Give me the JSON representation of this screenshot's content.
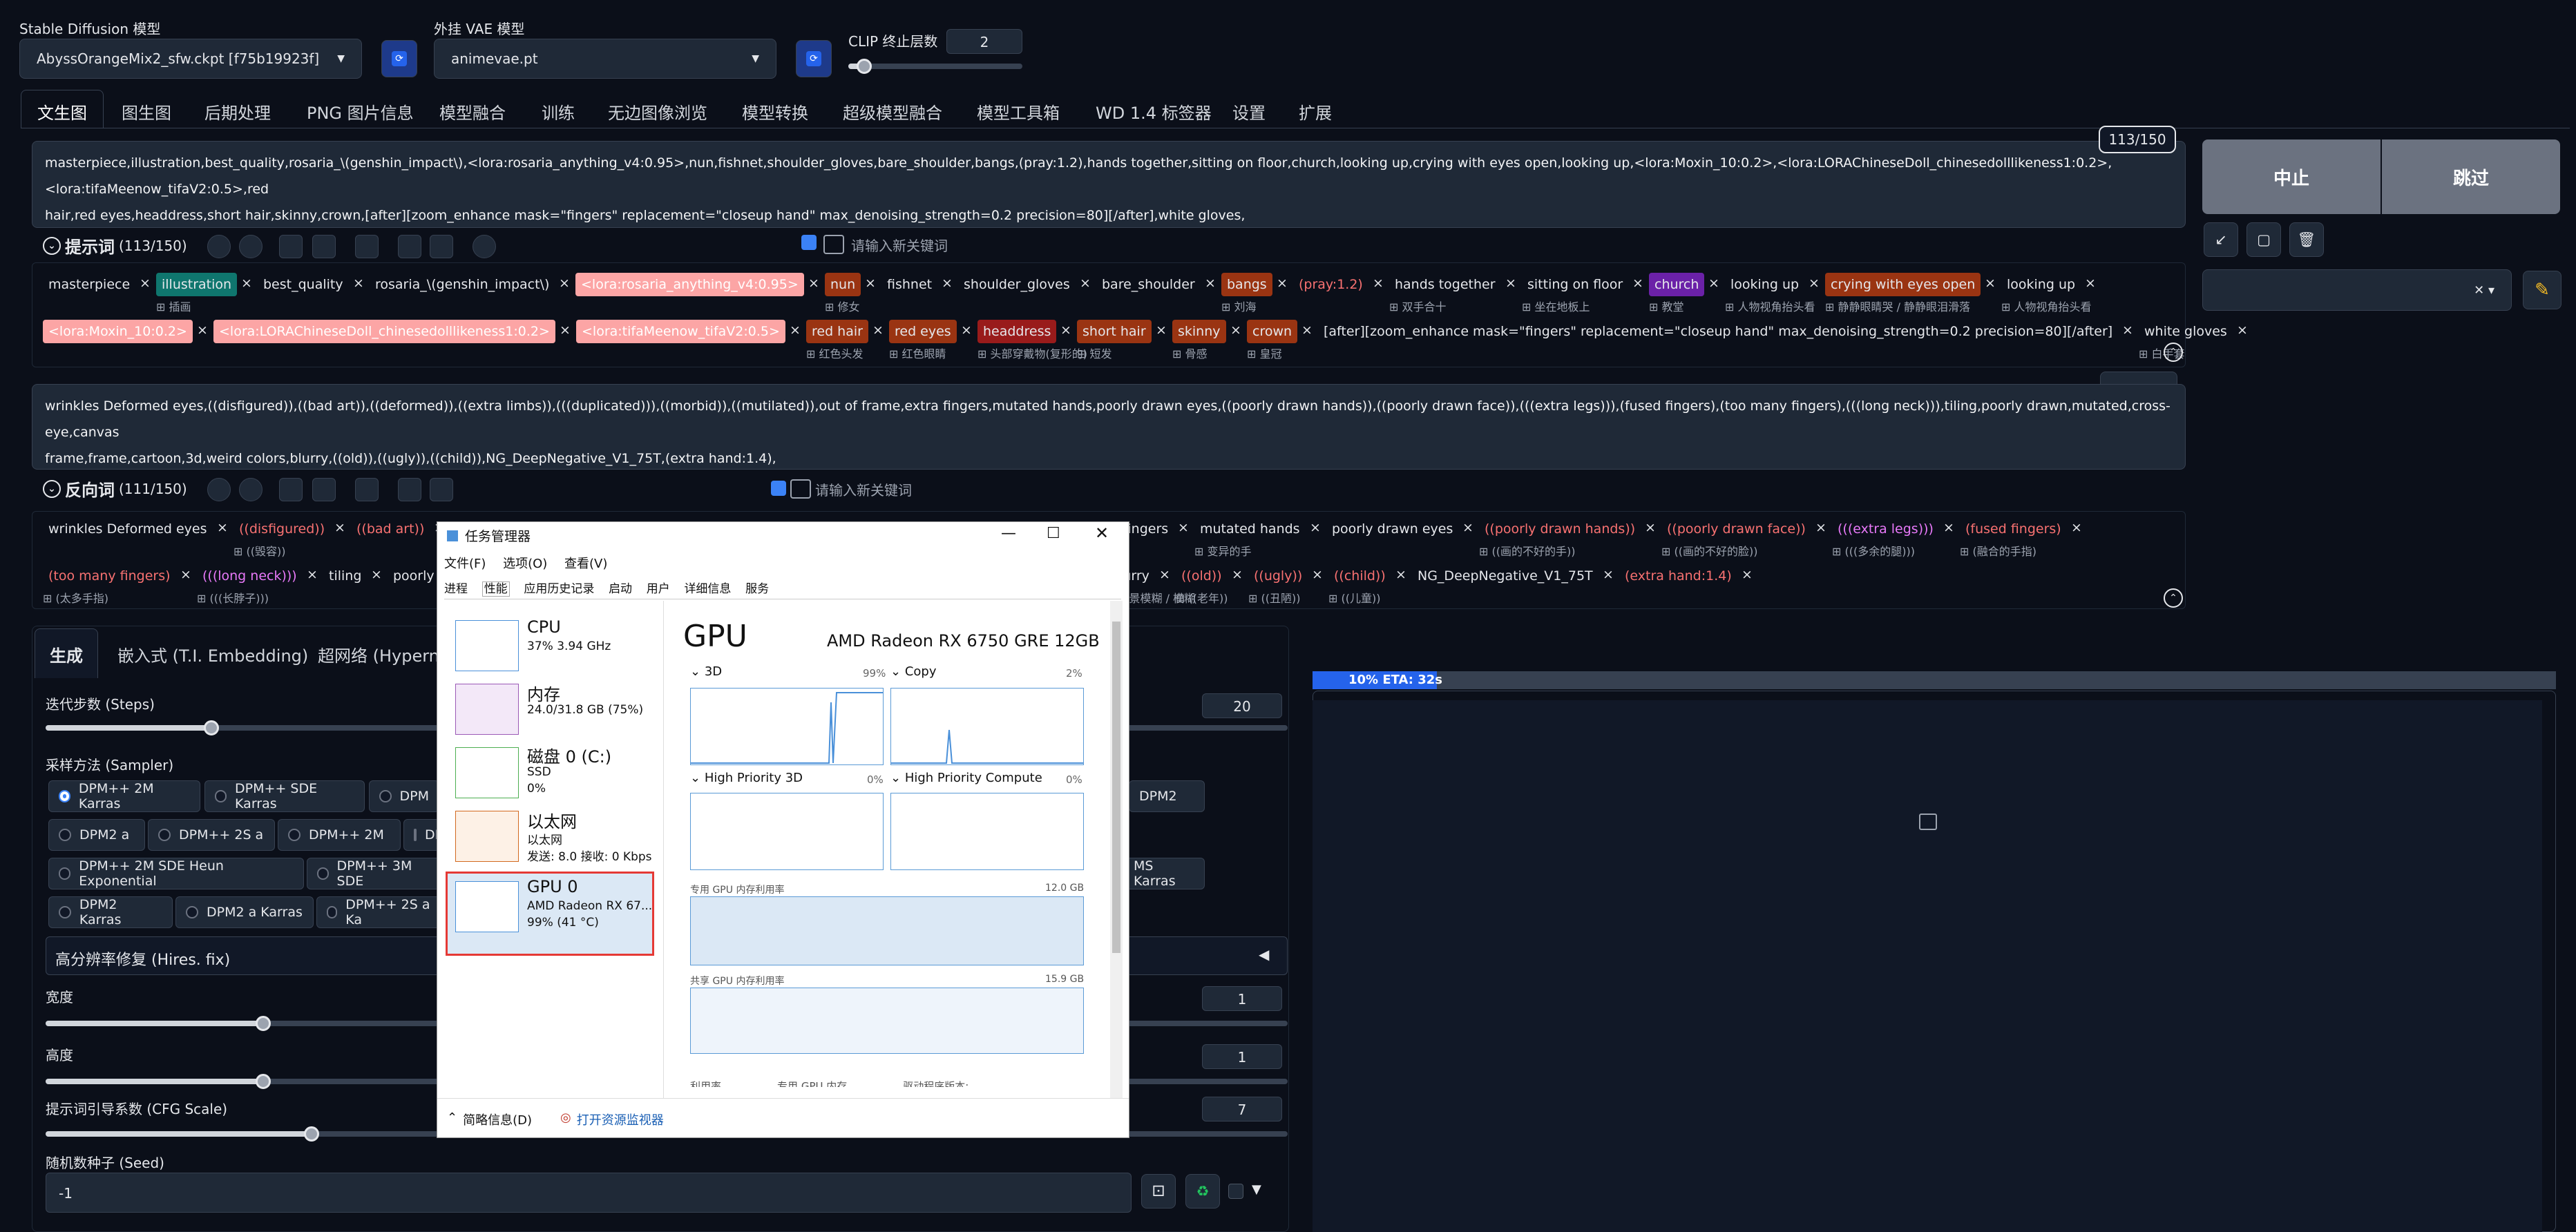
{
  "top": {
    "sd_model_label": "Stable Diffusion 模型",
    "sd_model_value": "AbyssOrangeMix2_sfw.ckpt [f75b19923f]",
    "vae_label": "外挂 VAE 模型",
    "vae_value": "animevae.pt",
    "clip_label": "CLIP 终止层数",
    "clip_value": "2"
  },
  "tabs": [
    "文生图",
    "图生图",
    "后期处理",
    "PNG 图片信息",
    "模型融合",
    "训练",
    "无边图像浏览",
    "模型转换",
    "超级模型融合",
    "模型工具箱",
    "WD 1.4 标签器",
    "设置",
    "扩展"
  ],
  "prompt": {
    "counter": "113/150",
    "line1": "masterpiece,illustration,best_quality,rosaria_\\(genshin_impact\\),<lora:rosaria_anything_v4:0.95>,nun,fishnet,shoulder_gloves,bare_shoulder,bangs,(pray:1.2),hands together,sitting on floor,church,looking up,crying with eyes open,looking up,<lora:Moxin_10:0.2>,<lora:LORAChineseDoll_chinesedolllikeness1:0.2>,<lora:tifaMeenow_tifaV2:0.5>,red",
    "line2": "hair,red eyes,headdress,short hair,skinny,crown,[after][zoom_enhance mask=\"fingers\" replacement=\"closeup hand\" max_denoising_strength=0.2 precision=80][/after],white gloves,",
    "header_label": "提示词",
    "header_count": "(113/150)",
    "new_keyword": "请输入新关键词"
  },
  "prompt_chips": [
    {
      "t": "masterpiece",
      "c": "",
      "s": ""
    },
    {
      "t": "illustration",
      "c": "cyan",
      "s": "插画"
    },
    {
      "t": "best_quality",
      "c": "",
      "s": ""
    },
    {
      "t": "rosaria_\\(genshin_impact\\)",
      "c": "",
      "s": ""
    },
    {
      "t": "<lora:rosaria_anything_v4:0.95>",
      "c": "pink",
      "s": ""
    },
    {
      "t": "nun",
      "c": "orange",
      "s": "修女"
    },
    {
      "t": "fishnet",
      "c": "",
      "s": ""
    },
    {
      "t": "shoulder_gloves",
      "c": "",
      "s": ""
    },
    {
      "t": "bare_shoulder",
      "c": "",
      "s": ""
    },
    {
      "t": "bangs",
      "c": "orange",
      "s": "刘海"
    },
    {
      "t": "(pray:1.2)",
      "c": "red",
      "s": ""
    },
    {
      "t": "hands together",
      "c": "",
      "s": "双手合十"
    },
    {
      "t": "sitting on floor",
      "c": "",
      "s": "坐在地板上"
    },
    {
      "t": "church",
      "c": "purple",
      "s": "教堂"
    },
    {
      "t": "looking up",
      "c": "",
      "s": "人物视角抬头看"
    },
    {
      "t": "crying with eyes open",
      "c": "orange",
      "s": "静静眼睛哭 / 静静眼泪滑落"
    },
    {
      "t": "looking up",
      "c": "",
      "s": "人物视角抬头看"
    },
    {
      "t": "<lora:Moxin_10:0.2>",
      "c": "pink",
      "s": ""
    },
    {
      "t": "<lora:LORAChineseDoll_chinesedolllikeness1:0.2>",
      "c": "pink",
      "s": ""
    },
    {
      "t": "<lora:tifaMeenow_tifaV2:0.5>",
      "c": "pink",
      "s": ""
    },
    {
      "t": "red hair",
      "c": "orange",
      "s": "红色头发"
    },
    {
      "t": "red eyes",
      "c": "orange",
      "s": "红色眼睛"
    },
    {
      "t": "headdress",
      "c": "redb",
      "s": "头部穿戴物(复形的)"
    },
    {
      "t": "short hair",
      "c": "orange",
      "s": "短发"
    },
    {
      "t": "skinny",
      "c": "orange",
      "s": "骨感"
    },
    {
      "t": "crown",
      "c": "orange",
      "s": "皇冠"
    },
    {
      "t": "[after][zoom_enhance mask=\"fingers\" replacement=\"closeup hand\" max_denoising_strength=0.2 precision=80][/after]",
      "c": "",
      "s": ""
    },
    {
      "t": "white gloves",
      "c": "",
      "s": "白手套"
    }
  ],
  "negative": {
    "line1": "wrinkles Deformed eyes,((disfigured)),((bad art)),((deformed)),((extra limbs)),(((duplicated))),((morbid)),((mutilated)),out of frame,extra fingers,mutated hands,poorly drawn eyes,((poorly drawn hands)),((poorly drawn face)),(((extra legs))),(fused fingers),(too many fingers),(((long neck))),tiling,poorly drawn,mutated,cross-eye,canvas",
    "line2": "frame,frame,cartoon,3d,weird colors,blurry,((old)),((ugly)),((child)),NG_DeepNegative_V1_75T,(extra hand:1.4),",
    "header_label": "反向词",
    "header_count": "(111/150)",
    "new_keyword": "请输入新关键词"
  },
  "neg_chips_row1": [
    {
      "t": "wrinkles Deformed eyes",
      "c": "",
      "s": ""
    },
    {
      "t": "((disfigured))",
      "c": "red",
      "s": "((毁容))"
    },
    {
      "t": "((bad art))",
      "c": "red",
      "s": ""
    },
    {
      "t": "a fingers",
      "c": "",
      "s": ""
    },
    {
      "t": "mutated hands",
      "c": "",
      "s": "变异的手"
    },
    {
      "t": "poorly drawn eyes",
      "c": "",
      "s": ""
    },
    {
      "t": "((poorly drawn hands))",
      "c": "red",
      "s": "((画的不好的手))"
    },
    {
      "t": "((poorly drawn face))",
      "c": "red",
      "s": "((画的不好的脸))"
    },
    {
      "t": "(((extra legs)))",
      "c": "mag",
      "s": "(((多余的腿)))"
    },
    {
      "t": "(fused fingers)",
      "c": "red",
      "s": "(融合的手指)"
    }
  ],
  "neg_chips_row2": [
    {
      "t": "(too many fingers)",
      "c": "red",
      "s": "(太多手指)"
    },
    {
      "t": "(((long neck)))",
      "c": "mag",
      "s": "(((长脖子)))"
    },
    {
      "t": "tiling",
      "c": "",
      "s": ""
    },
    {
      "t": "poorly dr",
      "c": "",
      "s": ""
    },
    {
      "t": "blurry",
      "c": "",
      "s": "背景模糊 / 模糊"
    },
    {
      "t": "((old))",
      "c": "red",
      "s": "((老年))"
    },
    {
      "t": "((ugly))",
      "c": "red",
      "s": "((丑陋))"
    },
    {
      "t": "((child))",
      "c": "red",
      "s": "((儿童))"
    },
    {
      "t": "NG_DeepNegative_V1_75T",
      "c": "",
      "s": ""
    },
    {
      "t": "(extra hand:1.4)",
      "c": "red",
      "s": ""
    }
  ],
  "right": {
    "interrupt": "中止",
    "skip": "跳过",
    "progress": "10% ETA: 32s",
    "progress_pct": 10
  },
  "gen": {
    "tabs": [
      "生成",
      "嵌入式 (T.I. Embedding)",
      "超网络 (Hypernet"
    ],
    "steps_label": "迭代步数 (Steps)",
    "steps_value": "20",
    "steps_frac": 0.13,
    "sampler_label": "采样方法 (Sampler)",
    "samplers_row1": [
      "DPM++ 2M Karras",
      "DPM++ SDE Karras",
      "DPM"
    ],
    "samplers_row2": [
      "DPM2 a",
      "DPM++ 2S a",
      "DPM++ 2M",
      "DP"
    ],
    "samplers_row3": [
      "DPM++ 2M SDE Heun Exponential",
      "DPM++ 3M SDE"
    ],
    "samplers_row4": [
      "DPM2 Karras",
      "DPM2 a Karras",
      "DPM++ 2S a Ka"
    ],
    "sampler_right1": "DPM2",
    "sampler_right2": "MS Karras",
    "hires_label": "高分辨率修复 (Hires. fix)",
    "width_label": "宽度",
    "width_value": "1",
    "height_label": "高度",
    "height_value": "1",
    "cfg_label": "提示词引导系数 (CFG Scale)",
    "cfg_value": "7",
    "seed_label": "随机数种子 (Seed)",
    "seed_value": "-1"
  },
  "taskmgr": {
    "title": "任务管理器",
    "menu": [
      "文件(F)",
      "选项(O)",
      "查看(V)"
    ],
    "tabs": [
      "进程",
      "性能",
      "应用历史记录",
      "启动",
      "用户",
      "详细信息",
      "服务"
    ],
    "items": [
      {
        "name": "CPU",
        "l1": "37% 3.94 GHz",
        "l2": ""
      },
      {
        "name": "内存",
        "l1": "24.0/31.8 GB (75%)",
        "l2": ""
      },
      {
        "name": "磁盘 0 (C:)",
        "l1": "SSD",
        "l2": "0%"
      },
      {
        "name": "以太网",
        "l1": "以太网",
        "l2": "发送: 8.0 接收: 0 Kbps"
      },
      {
        "name": "GPU 0",
        "l1": "AMD Radeon RX 67...",
        "l2": "99% (41 °C)"
      }
    ],
    "gpu_title": "GPU",
    "gpu_model": "AMD Radeon RX 6750 GRE 12GB",
    "g1": "3D",
    "g1p": "99%",
    "g2": "Copy",
    "g2p": "2%",
    "g3": "High Priority 3D",
    "g3p": "0%",
    "g4": "High Priority Compute",
    "g4p": "0%",
    "ded_label": "专用 GPU 内存利用率",
    "ded_val": "12.0 GB",
    "shr_label": "共享 GPU 内存利用率",
    "shr_val": "15.9 GB",
    "bottom_cut": "利用率                 专用 GPU 内存                 驱动程序版本:",
    "footer_brief": "简略信息(D)",
    "footer_monitor": "打开资源监视器"
  }
}
